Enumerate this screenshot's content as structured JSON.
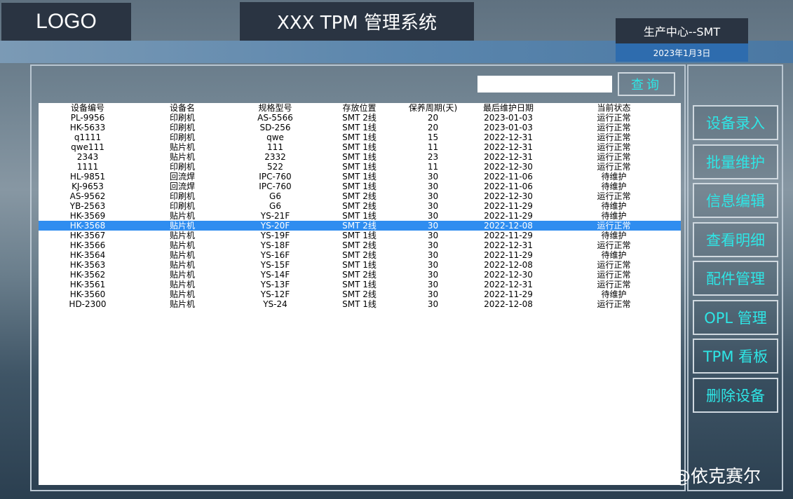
{
  "header": {
    "logo": "LOGO",
    "title": "XXX TPM 管理系统",
    "center": "生产中心--SMT",
    "date": "2023年1月3日"
  },
  "search": {
    "value": "",
    "placeholder": "",
    "button_label": "查询"
  },
  "table": {
    "columns": [
      "设备编号",
      "设备名",
      "规格型号",
      "存放位置",
      "保养周期(天)",
      "最后维护日期",
      "当前状态"
    ],
    "rows": [
      [
        "PL-9956",
        "印刷机",
        "AS-5566",
        "SMT 2线",
        "20",
        "2023-01-03",
        "运行正常"
      ],
      [
        "HK-5633",
        "印刷机",
        "SD-256",
        "SMT 1线",
        "20",
        "2023-01-03",
        "运行正常"
      ],
      [
        "q1111",
        "印刷机",
        "qwe",
        "SMT 1线",
        "15",
        "2022-12-31",
        "运行正常"
      ],
      [
        "qwe111",
        "贴片机",
        "111",
        "SMT 1线",
        "11",
        "2022-12-31",
        "运行正常"
      ],
      [
        "2343",
        "贴片机",
        "2332",
        "SMT 1线",
        "23",
        "2022-12-31",
        "运行正常"
      ],
      [
        "1111",
        "印刷机",
        "522",
        "SMT 1线",
        "11",
        "2022-12-30",
        "运行正常"
      ],
      [
        "HL-9851",
        "回流焊",
        "IPC-760",
        "SMT 1线",
        "30",
        "2022-11-06",
        "待维护"
      ],
      [
        "KJ-9653",
        "回流焊",
        "IPC-760",
        "SMT 1线",
        "30",
        "2022-11-06",
        "待维护"
      ],
      [
        "AS-9562",
        "印刷机",
        "G6",
        "SMT 2线",
        "30",
        "2022-12-30",
        "运行正常"
      ],
      [
        "YB-2563",
        "印刷机",
        "G6",
        "SMT 2线",
        "30",
        "2022-11-29",
        "待维护"
      ],
      [
        "HK-3569",
        "贴片机",
        "YS-21F",
        "SMT 1线",
        "30",
        "2022-11-29",
        "待维护"
      ],
      [
        "HK-3568",
        "贴片机",
        "YS-20F",
        "SMT 2线",
        "30",
        "2022-12-08",
        "运行正常"
      ],
      [
        "HK-3567",
        "贴片机",
        "YS-19F",
        "SMT 1线",
        "30",
        "2022-11-29",
        "待维护"
      ],
      [
        "HK-3566",
        "贴片机",
        "YS-18F",
        "SMT 2线",
        "30",
        "2022-12-31",
        "运行正常"
      ],
      [
        "HK-3564",
        "贴片机",
        "YS-16F",
        "SMT 2线",
        "30",
        "2022-11-29",
        "待维护"
      ],
      [
        "HK-3563",
        "贴片机",
        "YS-15F",
        "SMT 1线",
        "30",
        "2022-12-08",
        "运行正常"
      ],
      [
        "HK-3562",
        "贴片机",
        "YS-14F",
        "SMT 2线",
        "30",
        "2022-12-30",
        "运行正常"
      ],
      [
        "HK-3561",
        "贴片机",
        "YS-13F",
        "SMT 1线",
        "30",
        "2022-12-31",
        "运行正常"
      ],
      [
        "HK-3560",
        "贴片机",
        "YS-12F",
        "SMT 2线",
        "30",
        "2022-11-29",
        "待维护"
      ],
      [
        "HD-2300",
        "贴片机",
        "YS-24",
        "SMT 1线",
        "30",
        "2022-12-08",
        "运行正常"
      ]
    ],
    "selected_row": 11
  },
  "sidebar": {
    "buttons": [
      "设备录入",
      "批量维护",
      "信息编辑",
      "查看明细",
      "配件管理",
      "OPL 管理",
      "TPM 看板",
      "删除设备"
    ]
  },
  "watermark": "头条 @依克赛尔",
  "colors": {
    "accent_text": "#2ee6e6",
    "selected_row": "#2f8df0",
    "header_box": "#2a3442",
    "date_bar": "#2e6cae"
  }
}
